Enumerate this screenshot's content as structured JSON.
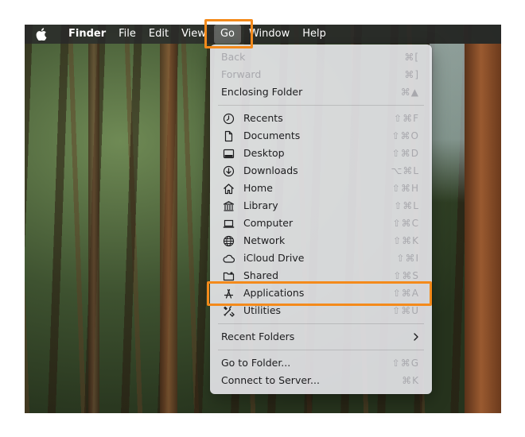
{
  "menubar": {
    "items": [
      {
        "label": "Finder",
        "bold": true
      },
      {
        "label": "File"
      },
      {
        "label": "Edit"
      },
      {
        "label": "View"
      },
      {
        "label": "Go",
        "active": true
      },
      {
        "label": "Window"
      },
      {
        "label": "Help"
      }
    ]
  },
  "menu": {
    "group1": [
      {
        "label": "Back",
        "shortcut": "⌘[",
        "disabled": true
      },
      {
        "label": "Forward",
        "shortcut": "⌘]",
        "disabled": true
      },
      {
        "label": "Enclosing Folder",
        "shortcut": "⌘▲"
      }
    ],
    "group2": [
      {
        "label": "Recents",
        "shortcut": "⇧⌘F",
        "icon": "clock-icon"
      },
      {
        "label": "Documents",
        "shortcut": "⇧⌘O",
        "icon": "document-icon"
      },
      {
        "label": "Desktop",
        "shortcut": "⇧⌘D",
        "icon": "desktop-icon"
      },
      {
        "label": "Downloads",
        "shortcut": "⌥⌘L",
        "icon": "download-icon"
      },
      {
        "label": "Home",
        "shortcut": "⇧⌘H",
        "icon": "home-icon"
      },
      {
        "label": "Library",
        "shortcut": "⇧⌘L",
        "icon": "library-icon"
      },
      {
        "label": "Computer",
        "shortcut": "⇧⌘C",
        "icon": "laptop-icon"
      },
      {
        "label": "Network",
        "shortcut": "⇧⌘K",
        "icon": "globe-icon"
      },
      {
        "label": "iCloud Drive",
        "shortcut": "⇧⌘I",
        "icon": "cloud-icon"
      },
      {
        "label": "Shared",
        "shortcut": "⇧⌘S",
        "icon": "shared-folder-icon"
      },
      {
        "label": "Applications",
        "shortcut": "⇧⌘A",
        "icon": "applications-icon",
        "highlighted": true
      },
      {
        "label": "Utilities",
        "shortcut": "⇧⌘U",
        "icon": "tools-icon"
      }
    ],
    "group3": [
      {
        "label": "Recent Folders",
        "submenu": true
      }
    ],
    "group4": [
      {
        "label": "Go to Folder...",
        "shortcut": "⇧⌘G"
      },
      {
        "label": "Connect to Server...",
        "shortcut": "⌘K"
      }
    ]
  },
  "colors": {
    "highlight": "#f48a1b"
  }
}
